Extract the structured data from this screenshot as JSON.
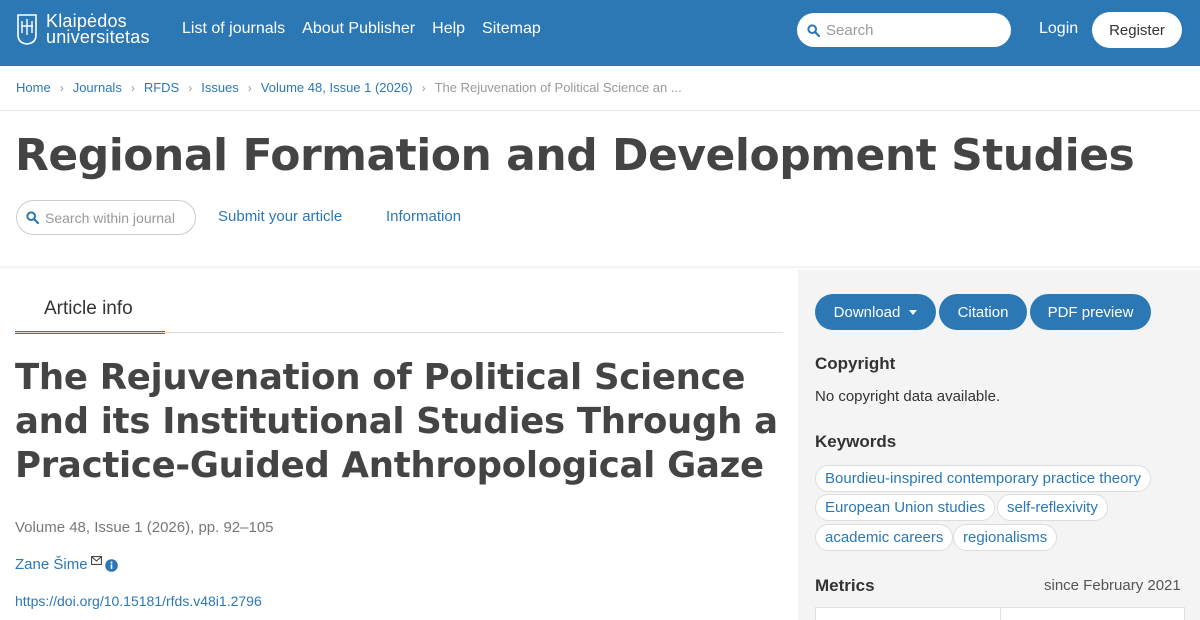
{
  "header": {
    "logo_line1": "Klaipėdos",
    "logo_line2": "universitetas",
    "nav": [
      "List of journals",
      "About Publisher",
      "Help",
      "Sitemap"
    ],
    "search_placeholder": "Search",
    "login": "Login",
    "register": "Register"
  },
  "breadcrumb": [
    "Home",
    "Journals",
    "RFDS",
    "Issues",
    "Volume 48, Issue 1 (2026)",
    "The Rejuvenation of Political Science an ..."
  ],
  "journal": {
    "title": "Regional Formation and Development Studies",
    "search_placeholder": "Search within journal",
    "links": [
      "Submit your article",
      "Information"
    ]
  },
  "article": {
    "tab": "Article info",
    "title": "The Rejuvenation of Political Science and its Institutional Studies Through a Practice-Guided Anthropological Gaze",
    "issue": "Volume 48, Issue 1 (2026), pp. 92–105",
    "author": "Zane Šime",
    "doi": "https://doi.org/10.15181/rfds.v48i1.2796"
  },
  "sidebar": {
    "buttons": {
      "download": "Download",
      "citation": "Citation",
      "pdf_preview": "PDF preview"
    },
    "copyright_heading": "Copyright",
    "copyright_text": "No copyright data available.",
    "keywords_heading": "Keywords",
    "keywords": [
      "Bourdieu-inspired contemporary practice theory",
      "European Union studies",
      "self-reflexivity",
      "academic careers",
      "regionalisms"
    ],
    "metrics_heading": "Metrics",
    "metrics_since": "since February 2021"
  },
  "colors": {
    "brand": "#2b78b5",
    "text": "#333333",
    "sidebar_bg": "#f4f4f4"
  }
}
